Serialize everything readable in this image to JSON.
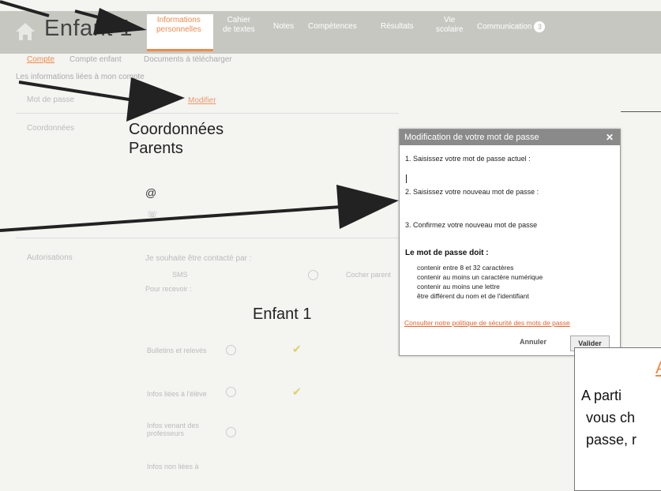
{
  "header": {
    "child_name": "Enfant 1",
    "nav_items": [
      {
        "line1": "Informations",
        "line2": "personnelles"
      },
      {
        "line1": "Cahier",
        "line2": "de textes"
      },
      {
        "line1": "Notes",
        "line2": ""
      },
      {
        "line1": "Compétences",
        "line2": ""
      },
      {
        "line1": "Résultats",
        "line2": ""
      },
      {
        "line1": "Vie",
        "line2": "scolaire"
      },
      {
        "line1": "Communication",
        "line2": ""
      }
    ],
    "communication_badge": "3"
  },
  "subtabs": [
    "Compte",
    "Compte enfant",
    "Documents à télécharger"
  ],
  "info_line": "Les informations liées à mon compte",
  "password_section": {
    "label": "Mot de passe",
    "link": "Modifier"
  },
  "contact_section": {
    "label": "Coordonnées",
    "title_line1": "Coordonnées",
    "title_line2": "Parents"
  },
  "auth_section": {
    "label": "Autorisations",
    "contact_by": "Je souhaite être contacté par :",
    "sms": "SMS",
    "receive": "Pour recevoir :",
    "child_heading": "Enfant 1",
    "right_text": "Cocher parent"
  },
  "receive_items": [
    {
      "line1": "Bulletins et relevés",
      "line2": ""
    },
    {
      "line1": "Infos liées à l'élève",
      "line2": ""
    },
    {
      "line1": "Infos venant des",
      "line2": "professeurs"
    },
    {
      "line1": "Infos non liées à",
      "line2": ""
    }
  ],
  "dialog": {
    "title": "Modification de votre mot de passe",
    "step1": "1. Saisissez votre mot de passe actuel :",
    "step2": "2. Saisissez votre nouveau mot de passe :",
    "step3": "3. Confirmez votre nouveau mot de passe",
    "rules_title": "Le mot de passe doit :",
    "rules": [
      "contenir entre 8 et 32 caractères",
      "contenir au moins un caractère numérique",
      "contenir au moins une lettre",
      "être différent du nom et de l'identifiant"
    ],
    "policy_link": "Consulter notre politique de sécurité des mots de passe",
    "cancel": "Annuler",
    "validate": "Valider"
  },
  "overlay": {
    "title": "A",
    "lines": [
      "A parti",
      "vous ch",
      "passe, r"
    ]
  }
}
